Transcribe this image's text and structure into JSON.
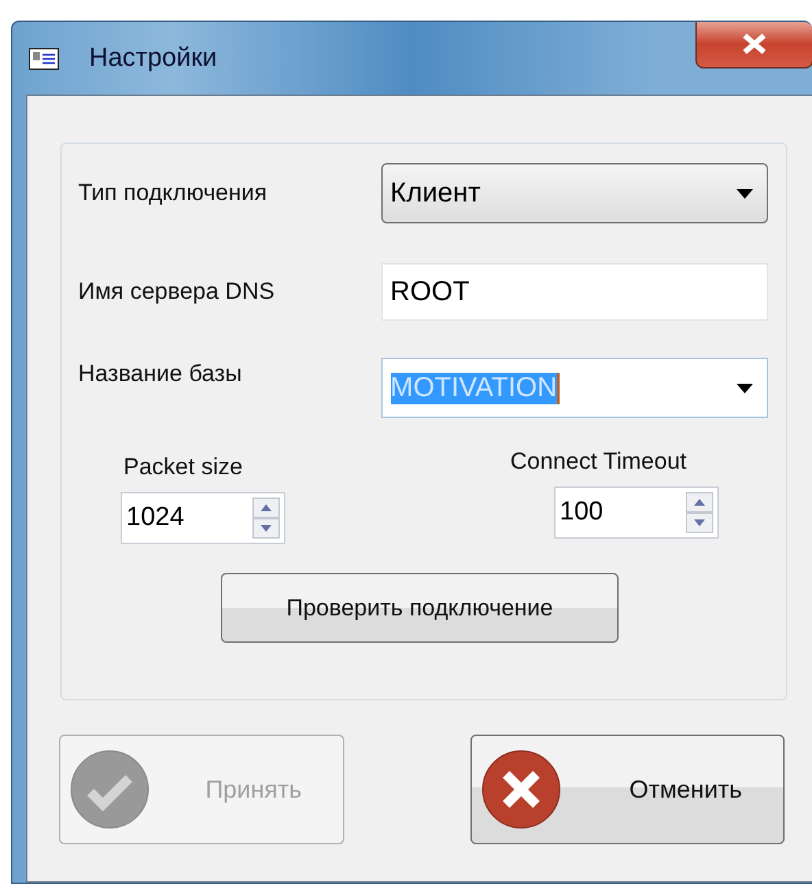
{
  "window": {
    "title": "Настройки"
  },
  "fields": [
    {
      "kind": "combo",
      "label": "Тип подключения",
      "value": "Клиент",
      "text_selected": false
    },
    {
      "kind": "text",
      "label": "Имя сервера DNS",
      "value": "ROOT",
      "text_selected": false
    },
    {
      "kind": "edit-combo",
      "label": "Название базы",
      "value": "MOTIVATION",
      "text_selected": true
    }
  ],
  "spinners": [
    {
      "label": "Packet size",
      "value": "1024"
    },
    {
      "label": "Connect Timeout",
      "value": "100"
    }
  ],
  "test_button": {
    "label": "Проверить подключение"
  },
  "buttons": [
    {
      "kind": "accept",
      "label": "Принять",
      "disabled": true
    },
    {
      "kind": "cancel",
      "label": "Отменить",
      "disabled": false
    }
  ]
}
